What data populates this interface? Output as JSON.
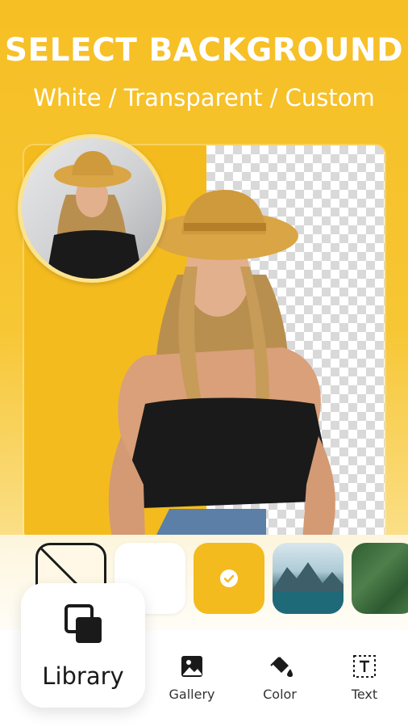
{
  "header": {
    "title": "SELECT BACKGROUND",
    "subtitle": "White / Transparent / Custom"
  },
  "colors": {
    "brand_yellow": "#f4bb1f",
    "text_dark": "#1a1a1a"
  },
  "backgrounds": [
    {
      "name": "none",
      "icon": "no-background-icon"
    },
    {
      "name": "white"
    },
    {
      "name": "yellow",
      "selected": true,
      "icon": "check-icon"
    },
    {
      "name": "lake-photo"
    },
    {
      "name": "green-leaf-photo"
    }
  ],
  "library": {
    "label": "Library",
    "icon": "library-icon"
  },
  "nav": {
    "gallery": {
      "label": "Gallery",
      "icon": "gallery-icon"
    },
    "color": {
      "label": "Color",
      "icon": "paint-bucket-icon"
    },
    "text": {
      "label": "Text",
      "icon": "text-icon"
    }
  }
}
